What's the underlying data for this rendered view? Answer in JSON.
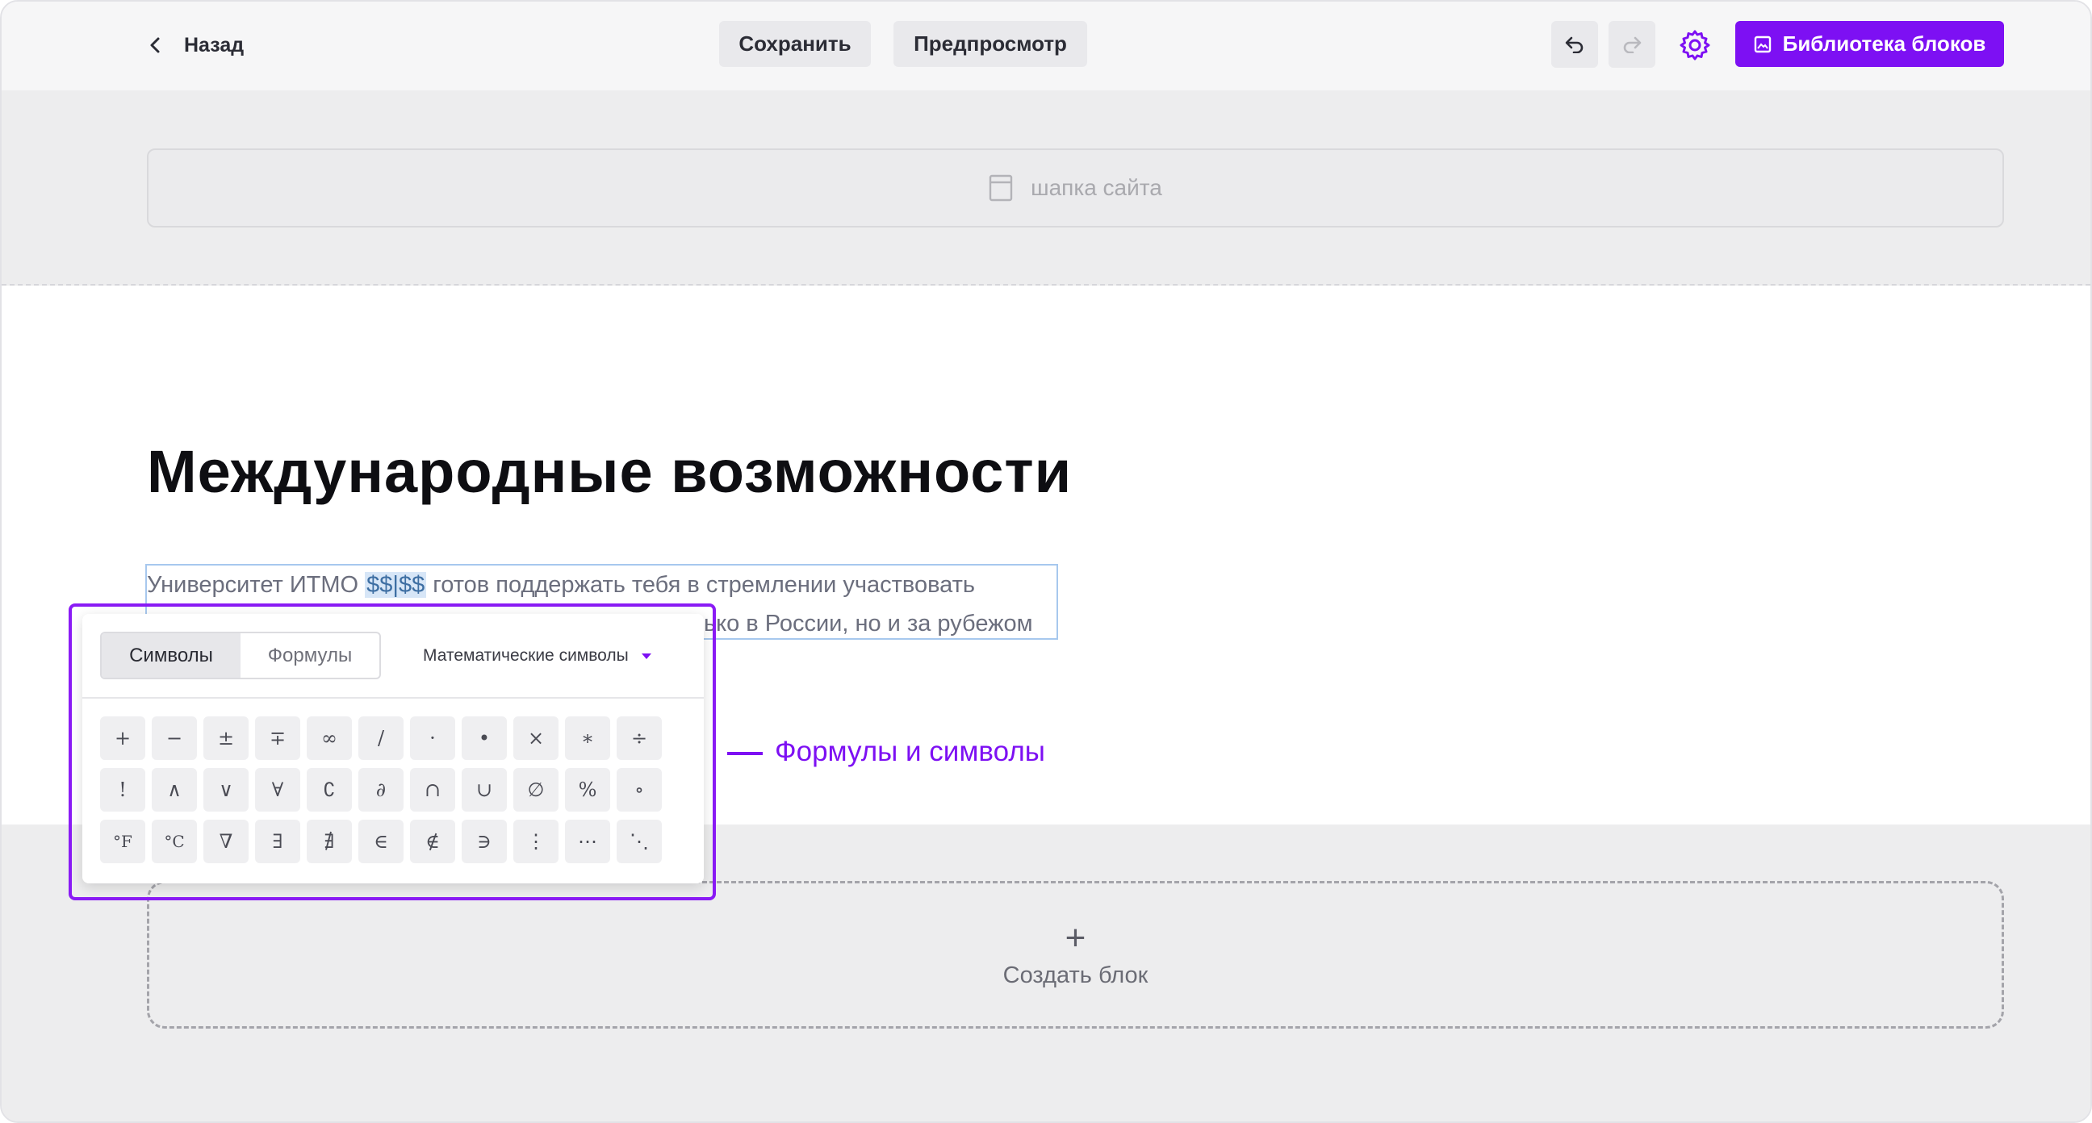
{
  "topbar": {
    "back_label": "Назад",
    "save_label": "Сохранить",
    "preview_label": "Предпросмотр",
    "library_label": "Библиотека блоков",
    "accent_color": "#7d10f3"
  },
  "header_block": {
    "label": "шапка сайта"
  },
  "content": {
    "title": "Международные возможности",
    "paragraph_line1_before": "Университет ИТМО ",
    "paragraph_line1_formula": "$$|$$",
    "paragraph_line1_after": " готов поддержать тебя в стремлении участвовать",
    "paragraph_line2_visible": "ько в России, но и за рубежом"
  },
  "symbols_popup": {
    "tabs": [
      "Символы",
      "Формулы"
    ],
    "active_tab": "Символы",
    "category": "Математические символы",
    "symbols": [
      "+",
      "−",
      "±",
      "∓",
      "∞",
      "/",
      "·",
      "•",
      "×",
      "∗",
      "÷",
      "!",
      "∧",
      "∨",
      "∀",
      "∁",
      "∂",
      "∩",
      "∪",
      "∅",
      "%",
      "∘",
      "°F",
      "°C",
      "∇",
      "∃",
      "∄",
      "∈",
      "∉",
      "∋",
      "⋮",
      "⋯",
      "⋱"
    ]
  },
  "annotation": {
    "label": "Формулы и символы"
  },
  "create_block": {
    "icon": "+",
    "label": "Создать блок"
  }
}
